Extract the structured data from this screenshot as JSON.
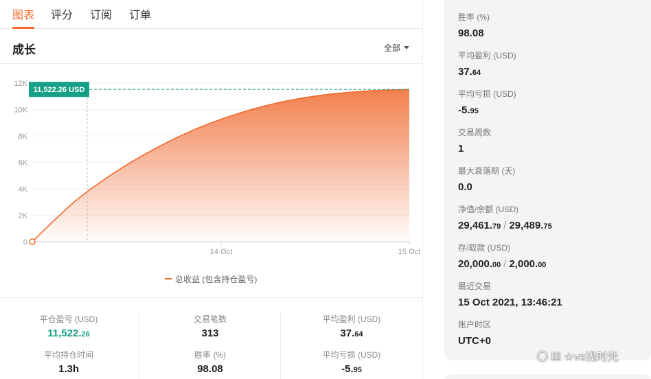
{
  "tabs": [
    {
      "label": "图表",
      "active": true
    },
    {
      "label": "评分",
      "active": false
    },
    {
      "label": "订阅",
      "active": false
    },
    {
      "label": "订单",
      "active": false
    }
  ],
  "section": {
    "title": "成长",
    "filter_label": "全部"
  },
  "chart_data": {
    "type": "area",
    "x_tick_labels": [
      "14 Oct",
      "15 Oct"
    ],
    "y_tick_labels": [
      "0",
      "2K",
      "4K",
      "6K",
      "8K",
      "10K",
      "12K"
    ],
    "ylim": [
      0,
      12000
    ],
    "series": [
      {
        "name": "总收益 (包含持仓盈亏)",
        "values": [
          0,
          3000,
          5300,
          7150,
          8650,
          9780,
          10600,
          11120,
          11400,
          11522.26
        ],
        "color": "#f0692e"
      }
    ],
    "annotation": "11,522.26 USD",
    "annotation_value": 11522.26,
    "grid": true,
    "legend_position": "bottom-center"
  },
  "stats": [
    {
      "label": "平仓盈亏 (USD)",
      "value_main": "11,522.",
      "value_small": "26",
      "highlight": true
    },
    {
      "label": "交易笔数",
      "value_main": "313",
      "value_small": ""
    },
    {
      "label": "平均盈利 (USD)",
      "value_main": "37.",
      "value_small": "64"
    },
    {
      "label": "平均持仓时间",
      "value_main": "1.3h",
      "value_small": ""
    },
    {
      "label": "胜率 (%)",
      "value_main": "98.08",
      "value_small": ""
    },
    {
      "label": "平均亏损 (USD)",
      "value_main": "-5.",
      "value_small": "95"
    }
  ],
  "summary": {
    "win_rate_label": "胜率 (%)",
    "win_rate": "98.08",
    "avg_profit_label": "平均盈利 (USD)",
    "avg_profit_main": "37.",
    "avg_profit_small": "64",
    "avg_loss_label": "平均亏损 (USD)",
    "avg_loss_main": "-5.",
    "avg_loss_small": "95",
    "weeks_label": "交易周数",
    "weeks": "1",
    "drawdown_label": "最大衰落期 (天)",
    "drawdown": "0.0",
    "equity_label": "净值/余额 (USD)",
    "equity_main": "29,461.",
    "equity_small": "79",
    "balance_main": "29,489.",
    "balance_small": "75",
    "deposit_label": "存/取款 (USD)",
    "deposit_main": "20,000.",
    "deposit_small": "00",
    "withdraw_main": "2,000.",
    "withdraw_small": "00",
    "last_trade_label": "最近交易",
    "last_trade": "15 Oct 2021, 13:46:21",
    "timezone_label": "账户时区",
    "timezone": "UTC+0",
    "separator": "/"
  },
  "watermark": "〇 ☒ ☆ve浅时光",
  "colors": {
    "accent": "#f0692e",
    "green": "#16a085",
    "tag": "#16a085"
  }
}
